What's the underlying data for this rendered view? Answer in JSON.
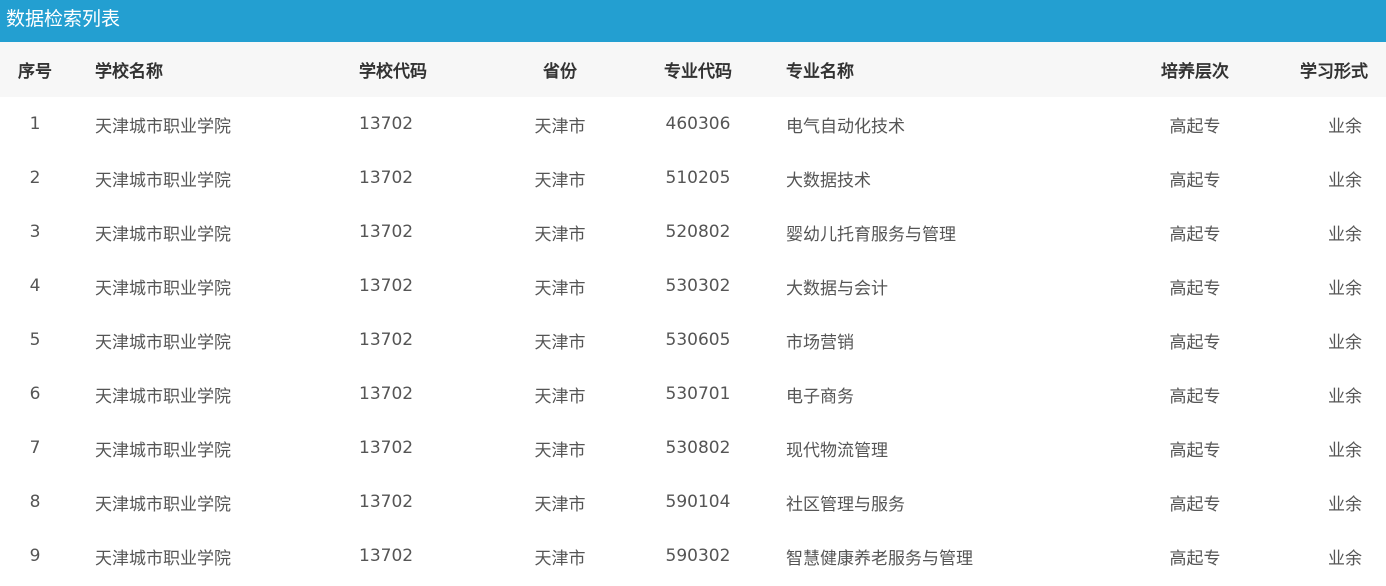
{
  "title": "数据检索列表",
  "headers": {
    "index": "序号",
    "school_name": "学校名称",
    "school_code": "学校代码",
    "province": "省份",
    "major_code": "专业代码",
    "major_name": "专业名称",
    "level": "培养层次",
    "study_form": "学习形式"
  },
  "rows": [
    {
      "index": "1",
      "school_name": "天津城市职业学院",
      "school_code": "13702",
      "province": "天津市",
      "major_code": "460306",
      "major_name": "电气自动化技术",
      "level": "高起专",
      "study_form": "业余"
    },
    {
      "index": "2",
      "school_name": "天津城市职业学院",
      "school_code": "13702",
      "province": "天津市",
      "major_code": "510205",
      "major_name": "大数据技术",
      "level": "高起专",
      "study_form": "业余"
    },
    {
      "index": "3",
      "school_name": "天津城市职业学院",
      "school_code": "13702",
      "province": "天津市",
      "major_code": "520802",
      "major_name": "婴幼儿托育服务与管理",
      "level": "高起专",
      "study_form": "业余"
    },
    {
      "index": "4",
      "school_name": "天津城市职业学院",
      "school_code": "13702",
      "province": "天津市",
      "major_code": "530302",
      "major_name": "大数据与会计",
      "level": "高起专",
      "study_form": "业余"
    },
    {
      "index": "5",
      "school_name": "天津城市职业学院",
      "school_code": "13702",
      "province": "天津市",
      "major_code": "530605",
      "major_name": "市场营销",
      "level": "高起专",
      "study_form": "业余"
    },
    {
      "index": "6",
      "school_name": "天津城市职业学院",
      "school_code": "13702",
      "province": "天津市",
      "major_code": "530701",
      "major_name": "电子商务",
      "level": "高起专",
      "study_form": "业余"
    },
    {
      "index": "7",
      "school_name": "天津城市职业学院",
      "school_code": "13702",
      "province": "天津市",
      "major_code": "530802",
      "major_name": "现代物流管理",
      "level": "高起专",
      "study_form": "业余"
    },
    {
      "index": "8",
      "school_name": "天津城市职业学院",
      "school_code": "13702",
      "province": "天津市",
      "major_code": "590104",
      "major_name": "社区管理与服务",
      "level": "高起专",
      "study_form": "业余"
    },
    {
      "index": "9",
      "school_name": "天津城市职业学院",
      "school_code": "13702",
      "province": "天津市",
      "major_code": "590302",
      "major_name": "智慧健康养老服务与管理",
      "level": "高起专",
      "study_form": "业余"
    }
  ]
}
